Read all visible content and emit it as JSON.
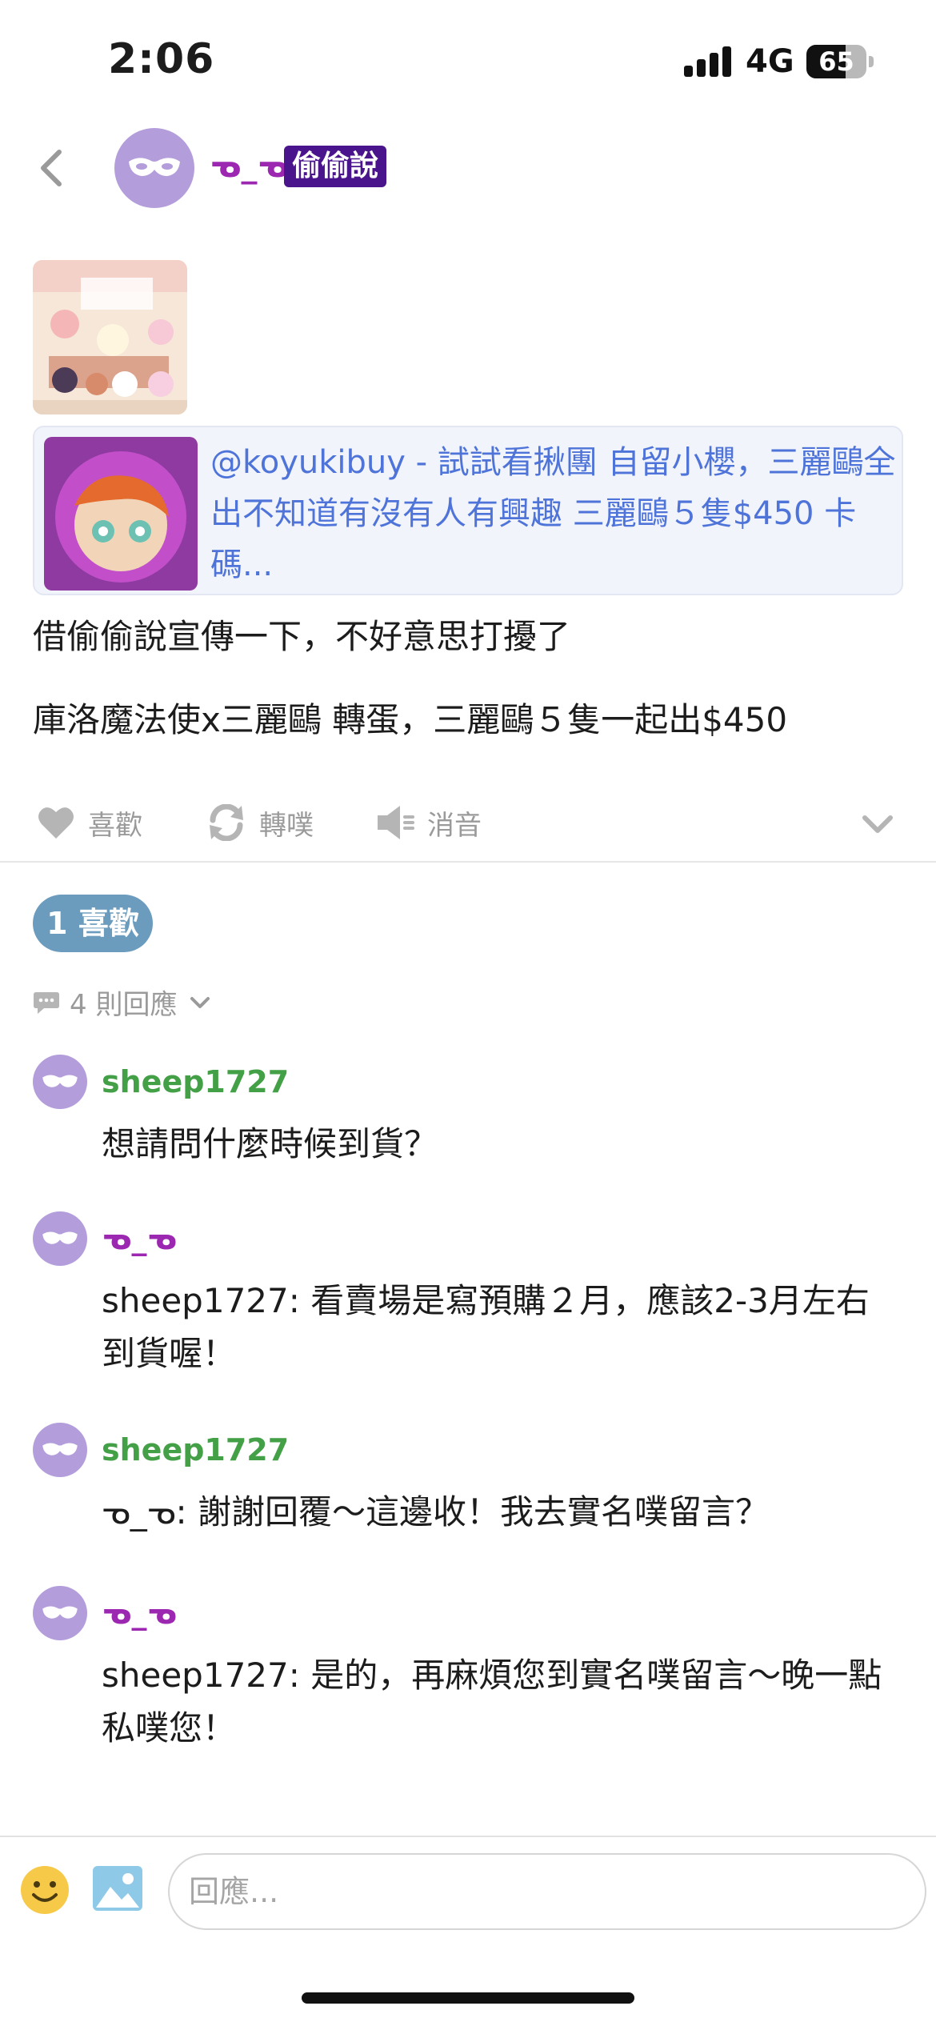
{
  "status_bar": {
    "time": "2:06",
    "network": "4G",
    "battery": "65",
    "battery_level": 0.65
  },
  "header": {
    "back_icon": "chevron-left-icon",
    "avatar_icon": "mask-icon",
    "author": "ᓀ_ᓀ",
    "badge": "偷偷說"
  },
  "post": {
    "link_card": {
      "text": "@koyukibuy - 試試看揪團 自留小櫻，三麗鷗全出不知道有沒有人有興趣 三麗鷗５隻$450 卡碼..."
    },
    "paragraphs": [
      "借偷偷說宣傳一下，不好意思打擾了",
      "庫洛魔法使x三麗鷗 轉蛋，三麗鷗５隻一起出$450"
    ]
  },
  "actions": {
    "like": "喜歡",
    "replurk": "轉噗",
    "mute": "消音",
    "icons": [
      "heart-icon",
      "replurk-icon",
      "mute-icon",
      "chevron-down-icon"
    ]
  },
  "likes_pill": "1 喜歡",
  "replies_summary": "4 則回應",
  "replies": [
    {
      "author": "sheep1727",
      "color": "#43a047",
      "text": "想請問什麼時候到貨？"
    },
    {
      "author": "ᓀ_ᓀ",
      "color": "#9c27b0",
      "text": "sheep1727: 看賣場是寫預購２月，應該2-3月左右到貨喔！"
    },
    {
      "author": "sheep1727",
      "color": "#43a047",
      "text": "ᓀ_ᓀ: 謝謝回覆～這邊收！我去實名噗留言？"
    },
    {
      "author": "ᓀ_ᓀ",
      "color": "#9c27b0",
      "text": "sheep1727: 是的，再麻煩您到實名噗留言～晚一點私噗您！"
    }
  ],
  "composer": {
    "placeholder": "回應...",
    "emoji_icon": "emoji-icon",
    "image_icon": "image-icon"
  },
  "colors": {
    "accent_blue": "#4f74d9",
    "likes_pill": "#6b9bbd",
    "badge_bg": "#4a148c",
    "avatar_bg": "#b39ddb"
  }
}
